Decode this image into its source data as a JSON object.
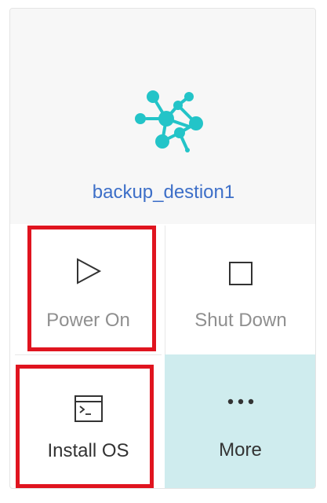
{
  "vm": {
    "name": "backup_destion1",
    "icon": "network-topology-icon",
    "icon_color": "#23c4c8"
  },
  "actions": {
    "power_on": {
      "label": "Power On",
      "icon": "play-icon"
    },
    "shut_down": {
      "label": "Shut Down",
      "icon": "stop-square-icon"
    },
    "install_os": {
      "label": "Install OS",
      "icon": "terminal-window-icon"
    },
    "more": {
      "label": "More",
      "icon": "ellipsis-icon"
    }
  },
  "colors": {
    "link_blue": "#3d6fc8",
    "highlight_red": "#e0141f",
    "more_bg": "#cfecee",
    "disabled_text": "#8f8f8f"
  }
}
